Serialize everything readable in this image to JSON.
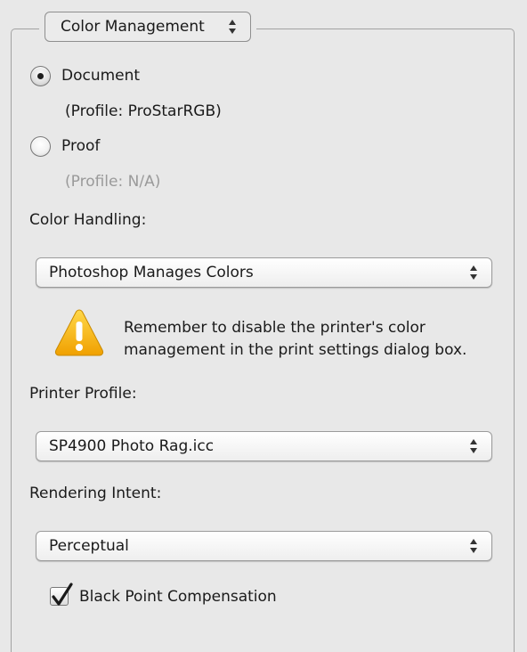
{
  "section_popup": {
    "label": "Color Management"
  },
  "print_mode": {
    "document_label": "Document",
    "document_profile": "(Profile: ProStarRGB)",
    "proof_label": "Proof",
    "proof_profile": "(Profile: N/A)",
    "selected": "Document"
  },
  "color_handling": {
    "label": "Color Handling:",
    "value": "Photoshop Manages Colors"
  },
  "warning": {
    "icon": "warning-triangle-icon",
    "line1": "Remember to disable the printer's color",
    "line2": "management in the print settings dialog box."
  },
  "printer_profile": {
    "label": "Printer Profile:",
    "value": "SP4900 Photo Rag.icc"
  },
  "rendering_intent": {
    "label": "Rendering Intent:",
    "value": "Perceptual"
  },
  "black_point": {
    "label": "Black Point Compensation",
    "checked": true
  },
  "colors": {
    "background": "#e8e8e8",
    "warning_yellow": "#f5b400",
    "dimmed_text": "#9a9a9a"
  }
}
